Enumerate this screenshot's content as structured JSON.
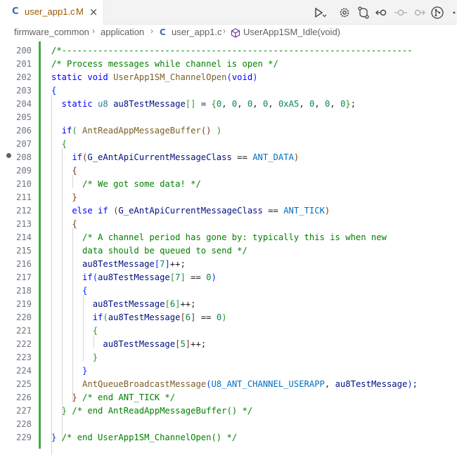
{
  "tab": {
    "lang_badge": "C",
    "filename": "user_app1.c",
    "modified_marker": "M",
    "close_glyph": "×"
  },
  "toolbar": {
    "icons": [
      "run-debug-icon",
      "settings-gear-icon",
      "source-control-icon",
      "go-back-icon",
      "go-circle-icon",
      "go-forward-icon",
      "merge-icon",
      "more-actions-icon"
    ]
  },
  "breadcrumb": {
    "items": [
      "firmware_common",
      "application",
      "user_app1.c",
      "UserApp1SM_Idle(void)"
    ],
    "file_badge": "C"
  },
  "editor": {
    "lines": [
      {
        "num": "200",
        "tokens": [
          {
            "t": "/*--------------------------------------------------------------------",
            "c": "c-com"
          }
        ]
      },
      {
        "num": "201",
        "tokens": [
          {
            "t": "/* Process messages while channel is open */",
            "c": "c-com"
          }
        ]
      },
      {
        "num": "202",
        "tokens": [
          {
            "t": "static ",
            "c": "c-kw"
          },
          {
            "t": "void ",
            "c": "c-kw"
          },
          {
            "t": "UserApp1SM_ChannelOpen",
            "c": "c-fn"
          },
          {
            "t": "(",
            "c": "c-br1"
          },
          {
            "t": "void",
            "c": "c-kw"
          },
          {
            "t": ")",
            "c": "c-br1"
          }
        ]
      },
      {
        "num": "203",
        "tokens": [
          {
            "t": "{",
            "c": "c-br1"
          }
        ]
      },
      {
        "num": "204",
        "tokens": [
          {
            "t": "  static ",
            "c": "c-kw"
          },
          {
            "t": "u8 ",
            "c": "c-ty"
          },
          {
            "t": "au8TestMessage",
            "c": "c-var"
          },
          {
            "t": "[]",
            "c": "c-br2"
          },
          {
            "t": " = ",
            "c": "c-pl"
          },
          {
            "t": "{",
            "c": "c-br2"
          },
          {
            "t": "0",
            "c": "c-num"
          },
          {
            "t": ", ",
            "c": "c-pl"
          },
          {
            "t": "0",
            "c": "c-num"
          },
          {
            "t": ", ",
            "c": "c-pl"
          },
          {
            "t": "0",
            "c": "c-num"
          },
          {
            "t": ", ",
            "c": "c-pl"
          },
          {
            "t": "0",
            "c": "c-num"
          },
          {
            "t": ", ",
            "c": "c-pl"
          },
          {
            "t": "0xA5",
            "c": "c-num"
          },
          {
            "t": ", ",
            "c": "c-pl"
          },
          {
            "t": "0",
            "c": "c-num"
          },
          {
            "t": ", ",
            "c": "c-pl"
          },
          {
            "t": "0",
            "c": "c-num"
          },
          {
            "t": ", ",
            "c": "c-pl"
          },
          {
            "t": "0",
            "c": "c-num"
          },
          {
            "t": "}",
            "c": "c-br2"
          },
          {
            "t": ";",
            "c": "c-pl"
          }
        ]
      },
      {
        "num": "205",
        "tokens": []
      },
      {
        "num": "206",
        "tokens": [
          {
            "t": "  if",
            "c": "c-kw"
          },
          {
            "t": "( ",
            "c": "c-br2"
          },
          {
            "t": "AntReadAppMessageBuffer",
            "c": "c-fn"
          },
          {
            "t": "()",
            "c": "c-br3"
          },
          {
            "t": " )",
            "c": "c-br2"
          }
        ]
      },
      {
        "num": "207",
        "tokens": [
          {
            "t": "  {",
            "c": "c-br2"
          }
        ]
      },
      {
        "num": "208",
        "tokens": [
          {
            "t": "    if",
            "c": "c-kw"
          },
          {
            "t": "(",
            "c": "c-br3"
          },
          {
            "t": "G_eAntApiCurrentMessageClass",
            "c": "c-var"
          },
          {
            "t": " == ",
            "c": "c-pl"
          },
          {
            "t": "ANT_DATA",
            "c": "c-mac"
          },
          {
            "t": ")",
            "c": "c-br3"
          }
        ]
      },
      {
        "num": "209",
        "tokens": [
          {
            "t": "    {",
            "c": "c-br3"
          }
        ]
      },
      {
        "num": "210",
        "tokens": [
          {
            "t": "      /* We got some data! */",
            "c": "c-com"
          }
        ]
      },
      {
        "num": "211",
        "tokens": [
          {
            "t": "    }",
            "c": "c-br3"
          }
        ]
      },
      {
        "num": "212",
        "tokens": [
          {
            "t": "    else if ",
            "c": "c-kw"
          },
          {
            "t": "(",
            "c": "c-br3"
          },
          {
            "t": "G_eAntApiCurrentMessageClass",
            "c": "c-var"
          },
          {
            "t": " == ",
            "c": "c-pl"
          },
          {
            "t": "ANT_TICK",
            "c": "c-mac"
          },
          {
            "t": ")",
            "c": "c-br3"
          }
        ]
      },
      {
        "num": "213",
        "tokens": [
          {
            "t": "    {",
            "c": "c-br3"
          }
        ]
      },
      {
        "num": "214",
        "tokens": [
          {
            "t": "      /* A channel period has gone by: typically this is when new",
            "c": "c-com"
          }
        ]
      },
      {
        "num": "215",
        "tokens": [
          {
            "t": "      data should be queued to send */",
            "c": "c-com"
          }
        ]
      },
      {
        "num": "216",
        "tokens": [
          {
            "t": "      au8TestMessage",
            "c": "c-var"
          },
          {
            "t": "[",
            "c": "c-br1"
          },
          {
            "t": "7",
            "c": "c-num"
          },
          {
            "t": "]",
            "c": "c-br1"
          },
          {
            "t": "++;",
            "c": "c-pl"
          }
        ]
      },
      {
        "num": "217",
        "tokens": [
          {
            "t": "      if",
            "c": "c-kw"
          },
          {
            "t": "(",
            "c": "c-br1"
          },
          {
            "t": "au8TestMessage",
            "c": "c-var"
          },
          {
            "t": "[",
            "c": "c-br2"
          },
          {
            "t": "7",
            "c": "c-num"
          },
          {
            "t": "]",
            "c": "c-br2"
          },
          {
            "t": " == ",
            "c": "c-pl"
          },
          {
            "t": "0",
            "c": "c-num"
          },
          {
            "t": ")",
            "c": "c-br1"
          }
        ]
      },
      {
        "num": "218",
        "tokens": [
          {
            "t": "      {",
            "c": "c-br1"
          }
        ]
      },
      {
        "num": "219",
        "tokens": [
          {
            "t": "        au8TestMessage",
            "c": "c-var"
          },
          {
            "t": "[",
            "c": "c-br2"
          },
          {
            "t": "6",
            "c": "c-num"
          },
          {
            "t": "]",
            "c": "c-br2"
          },
          {
            "t": "++;",
            "c": "c-pl"
          }
        ]
      },
      {
        "num": "220",
        "tokens": [
          {
            "t": "        if",
            "c": "c-kw"
          },
          {
            "t": "(",
            "c": "c-br2"
          },
          {
            "t": "au8TestMessage",
            "c": "c-var"
          },
          {
            "t": "[",
            "c": "c-br3"
          },
          {
            "t": "6",
            "c": "c-num"
          },
          {
            "t": "]",
            "c": "c-br3"
          },
          {
            "t": " == ",
            "c": "c-pl"
          },
          {
            "t": "0",
            "c": "c-num"
          },
          {
            "t": ")",
            "c": "c-br2"
          }
        ]
      },
      {
        "num": "221",
        "tokens": [
          {
            "t": "        {",
            "c": "c-br2"
          }
        ]
      },
      {
        "num": "222",
        "tokens": [
          {
            "t": "          au8TestMessage",
            "c": "c-var"
          },
          {
            "t": "[",
            "c": "c-br3"
          },
          {
            "t": "5",
            "c": "c-num"
          },
          {
            "t": "]",
            "c": "c-br3"
          },
          {
            "t": "++;",
            "c": "c-pl"
          }
        ]
      },
      {
        "num": "223",
        "tokens": [
          {
            "t": "        }",
            "c": "c-br2"
          }
        ]
      },
      {
        "num": "224",
        "tokens": [
          {
            "t": "      }",
            "c": "c-br1"
          }
        ]
      },
      {
        "num": "225",
        "tokens": [
          {
            "t": "      AntQueueBroadcastMessage",
            "c": "c-fn"
          },
          {
            "t": "(",
            "c": "c-br1"
          },
          {
            "t": "U8_ANT_CHANNEL_USERAPP",
            "c": "c-mac"
          },
          {
            "t": ", ",
            "c": "c-pl"
          },
          {
            "t": "au8TestMessage",
            "c": "c-var"
          },
          {
            "t": ")",
            "c": "c-br1"
          },
          {
            "t": ";",
            "c": "c-pl"
          }
        ]
      },
      {
        "num": "226",
        "tokens": [
          {
            "t": "    }",
            "c": "c-br3"
          },
          {
            "t": " /* end ANT_TICK */",
            "c": "c-com"
          }
        ]
      },
      {
        "num": "227",
        "tokens": [
          {
            "t": "  }",
            "c": "c-br2"
          },
          {
            "t": " /* end AntReadAppMessageBuffer() */",
            "c": "c-com"
          }
        ]
      },
      {
        "num": "228",
        "tokens": []
      },
      {
        "num": "229",
        "tokens": [
          {
            "t": "}",
            "c": "c-br1"
          },
          {
            "t": " /* end UserApp1SM_ChannelOpen() */",
            "c": "c-com"
          }
        ]
      }
    ]
  },
  "colors": {
    "gutter_modified": "#48a849",
    "comment": "#008000",
    "keyword": "#0000ff",
    "function": "#795e26",
    "variable": "#001080",
    "macro": "#0070c1",
    "number": "#098658"
  }
}
